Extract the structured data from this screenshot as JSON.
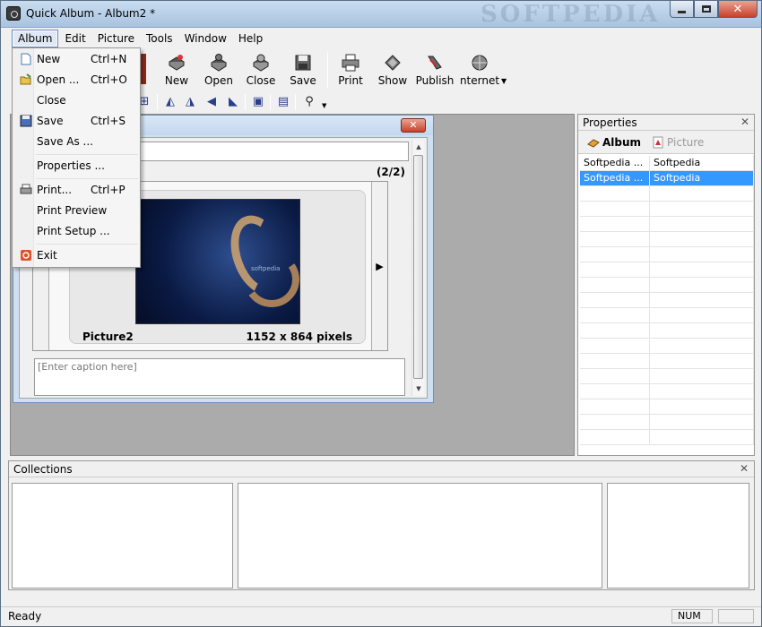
{
  "window": {
    "title": "Quick Album - Album2 *",
    "watermark": "SOFTPEDIA"
  },
  "menubar": {
    "items": [
      "Album",
      "Edit",
      "Picture",
      "Tools",
      "Window",
      "Help"
    ]
  },
  "toolbar": {
    "buttons": [
      {
        "label": "New",
        "icon": "new-album-icon"
      },
      {
        "label": "Open",
        "icon": "open-album-icon"
      },
      {
        "label": "Close",
        "icon": "close-album-icon"
      },
      {
        "label": "Save",
        "icon": "floppy-icon"
      },
      {
        "label": "Print",
        "icon": "printer-icon"
      },
      {
        "label": "Show",
        "icon": "slideshow-icon"
      },
      {
        "label": "Publish",
        "icon": "publish-icon"
      },
      {
        "label": "Internet",
        "icon": "globe-icon"
      }
    ],
    "internet_display": "nternet"
  },
  "album_menu": {
    "items": [
      {
        "label": "New",
        "shortcut": "Ctrl+N"
      },
      {
        "label": "Open ...",
        "shortcut": "Ctrl+O"
      },
      {
        "label": "Close",
        "shortcut": ""
      },
      {
        "label": "Save",
        "shortcut": "Ctrl+S"
      },
      {
        "label": "Save As ...",
        "shortcut": ""
      },
      {
        "label": "Properties ...",
        "shortcut": ""
      },
      {
        "label": "Print...",
        "shortcut": "Ctrl+P"
      },
      {
        "label": "Print Preview",
        "shortcut": ""
      },
      {
        "label": "Print Setup ...",
        "shortcut": ""
      },
      {
        "label": "Exit",
        "shortcut": ""
      }
    ]
  },
  "album_window": {
    "counter": "(2/2)",
    "picture_name": "Picture2",
    "picture_size": "1152 x 864 pixels",
    "caption_placeholder": "[Enter caption here]"
  },
  "properties": {
    "title": "Properties",
    "tabs": [
      "Album",
      "Picture"
    ],
    "rows": [
      {
        "key": "Softpedia ...",
        "value": "Softpedia",
        "selected": false
      },
      {
        "key": "Softpedia ...",
        "value": "Softpedia",
        "selected": true
      }
    ]
  },
  "collections": {
    "title": "Collections"
  },
  "statusbar": {
    "status": "Ready",
    "num": "NUM"
  },
  "colors": {
    "selection": "#3399ff",
    "titlebar": "#b9d0e8",
    "close_button": "#c8412a"
  }
}
